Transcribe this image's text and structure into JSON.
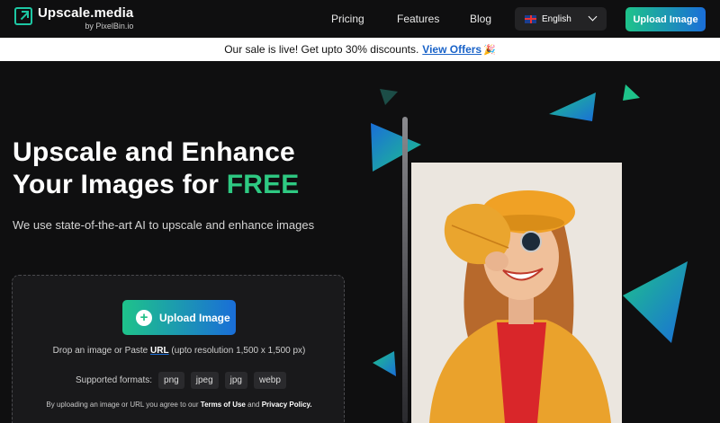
{
  "brand": {
    "name": "Upscale.media",
    "sub": "by PixelBin.io"
  },
  "nav": {
    "links": [
      "Pricing",
      "Features",
      "Blog"
    ],
    "language": "English",
    "upload_label": "Upload Image"
  },
  "banner": {
    "text": "Our sale is live! Get upto 30% discounts.",
    "link": "View Offers",
    "emoji": "🎉"
  },
  "hero": {
    "line1": "Upscale and Enhance",
    "line2_prefix": "Your Images for ",
    "line2_highlight": "FREE",
    "subtitle": "We use state-of-the-art AI to upscale and enhance images"
  },
  "upload_box": {
    "button_label": "Upload Image",
    "drop_prefix": "Drop an image or Paste",
    "drop_url": "URL",
    "drop_suffix": "(upto resolution 1,500 x 1,500 px)",
    "formats_label": "Supported formats:",
    "formats": [
      "png",
      "jpeg",
      "jpg",
      "webp"
    ],
    "terms_prefix": "By uploading an image or URL you agree to our",
    "terms_link": "Terms of Use",
    "terms_and": "and",
    "privacy_link": "Privacy Policy."
  },
  "colors": {
    "accent_green": "#2ec982",
    "accent_blue": "#1a6ed8",
    "background": "#0f0f10",
    "link": "#1a63c8"
  }
}
